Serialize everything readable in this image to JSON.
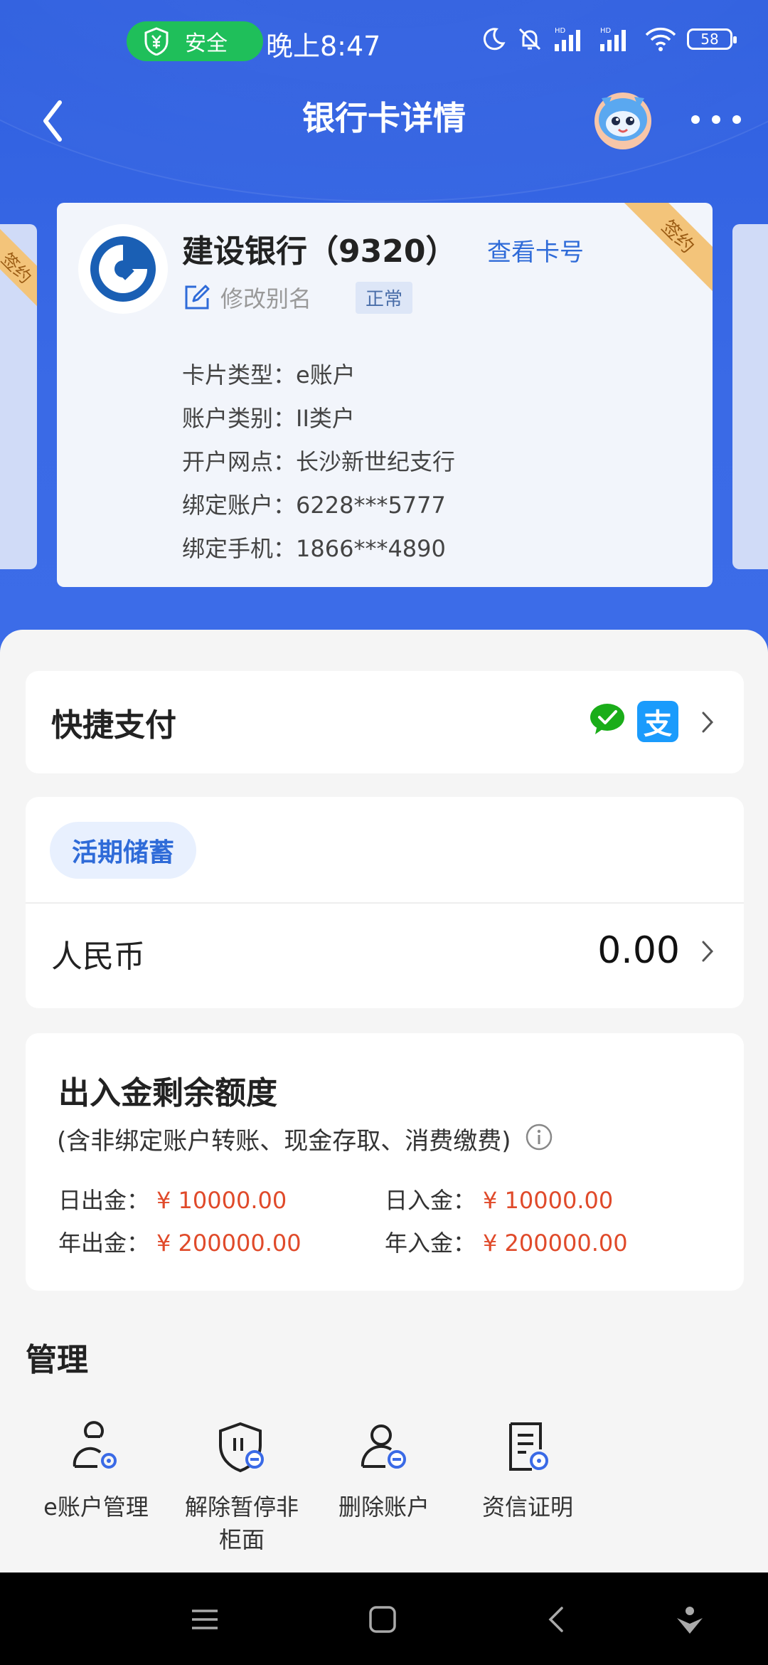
{
  "status_bar": {
    "safe_label": "安全",
    "time": "晚上8:47",
    "battery": "58"
  },
  "nav": {
    "title": "银行卡详情"
  },
  "card": {
    "bank_name": "建设银行（9320）",
    "view_card_no": "查看卡号",
    "edit_alias": "修改别名",
    "status": "正常",
    "ribbon": "签约",
    "side_ribbon": "签约",
    "info": [
      "卡片类型：e账户",
      "账户类别：II类户",
      "开户网点：长沙新世纪支行",
      "绑定账户：6228***5777",
      "绑定手机：1866***4890"
    ]
  },
  "quick_pay": {
    "title": "快捷支付",
    "alipay_glyph": "支"
  },
  "savings": {
    "tag": "活期储蓄",
    "currency": "人民币",
    "balance": "0.00"
  },
  "limits": {
    "title": "出入金剩余额度",
    "subtitle": "(含非绑定账户转账、现金存取、消费缴费)",
    "daily_out_label": "日出金：",
    "daily_out_value": "¥ 10000.00",
    "daily_in_label": "日入金：",
    "daily_in_value": "¥ 10000.00",
    "yearly_out_label": "年出金：",
    "yearly_out_value": "¥ 200000.00",
    "yearly_in_label": "年入金：",
    "yearly_in_value": "¥ 200000.00"
  },
  "manage": {
    "title": "管理",
    "items": [
      {
        "label": "e账户管理"
      },
      {
        "label": "解除暂停非柜面"
      },
      {
        "label": "删除账户"
      },
      {
        "label": "资信证明"
      }
    ]
  },
  "colors": {
    "header_blue": "#2f5fe0",
    "link_blue": "#2f6bd8",
    "amount_red": "#e04a2a",
    "safe_green": "#1fbf5a"
  }
}
